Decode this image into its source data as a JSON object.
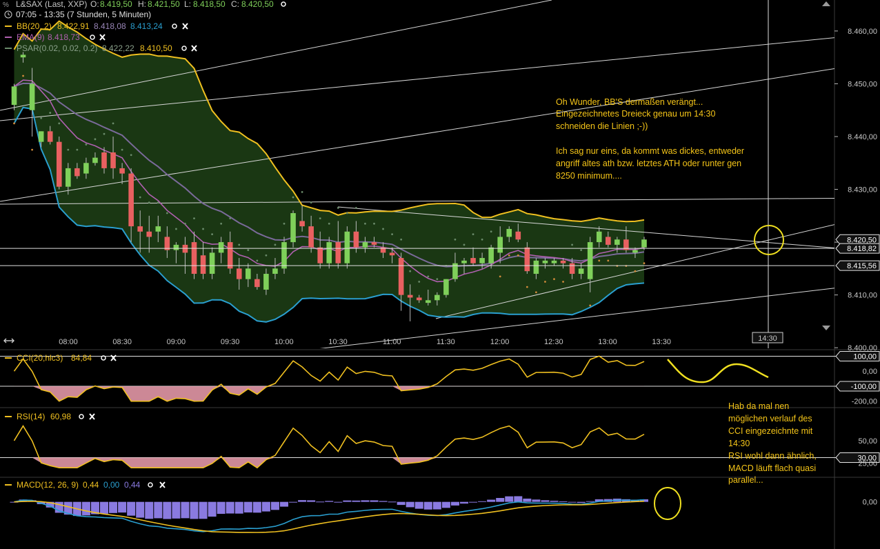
{
  "header": {
    "instrument": "L&SAX (Last, XXP)",
    "ohlc": {
      "o_label": "O:",
      "o": "8.419,50",
      "h_label": "H:",
      "h": "8.421,50",
      "l_label": "L:",
      "l": "8.418,50",
      "c_label": "C:",
      "c": "8.420,50"
    },
    "period": "07:05 - 13:35 (7 Stunden, 5 Minuten)"
  },
  "legend": {
    "bb": {
      "label": "BB(20, 2)",
      "v1": "8.422,91",
      "v2": "8.418,08",
      "v3": "8.413,24"
    },
    "ema": {
      "label": "EMA(9)",
      "v1": "8.418,73"
    },
    "psar": {
      "label": "PSAR(0.02, 0.02, 0.2)",
      "v1": "8.422,22",
      "v2": "8.410,50"
    },
    "cci": {
      "label": "CCI(20,hlc3)",
      "v1": "84,84"
    },
    "rsi": {
      "label": "RSI(14)",
      "v1": "60,98"
    },
    "macd": {
      "label": "MACD(12, 26, 9)",
      "v1": "0,44",
      "v2": "0,00",
      "v3": "0,44"
    }
  },
  "colors": {
    "bb": "#f0c020",
    "bb_fill": "#1b3a14",
    "ema": "#b060b0",
    "ema_slow": "#7a6a9a",
    "psar": "#6a8a6a",
    "lower_band": "#2a9fd0",
    "up": "#7fd05a",
    "down": "#e86060",
    "cci": "#f0c020",
    "cci_fill": "#f0a0b0",
    "hist": "#8a7ae0",
    "macd_signal": "#2a9fd0",
    "annotation": "#f5c518"
  },
  "chart_data": [
    {
      "type": "candlestick",
      "name": "price",
      "x": [
        "08:00",
        "08:30",
        "09:00",
        "09:30",
        "10:00",
        "10:30",
        "11:00",
        "11:30",
        "12:00",
        "12:30",
        "13:00",
        "13:30"
      ],
      "x_ticks": [
        "08:00",
        "08:30",
        "09:00",
        "09:30",
        "10:00",
        "10:30",
        "11:00",
        "11:30",
        "12:00",
        "12:30",
        "13:00",
        "13:30"
      ],
      "y_ticks": [
        "8.400,00",
        "8.410,00",
        "8.420,00",
        "8.430,00",
        "8.440,00",
        "8.450,00",
        "8.460,00"
      ],
      "y_tick_values": [
        8400,
        8410,
        8420,
        8430,
        8440,
        8450,
        8460
      ],
      "ylim": [
        8399.5,
        8466
      ],
      "price_tags": [
        {
          "label": "8.420,50",
          "value": 8420.5
        },
        {
          "label": "8.418,82",
          "value": 8418.82
        },
        {
          "label": "8.415,56",
          "value": 8415.56
        }
      ],
      "cursor": {
        "time_label": "14:30"
      },
      "candles": [
        {
          "o": 8446.0,
          "h": 8450.0,
          "l": 8445.0,
          "c": 8449.5
        },
        {
          "o": 8455.0,
          "h": 8456.0,
          "l": 8454.0,
          "c": 8455.5
        },
        {
          "o": 8445.0,
          "h": 8453.0,
          "l": 8440.0,
          "c": 8450.0
        },
        {
          "o": 8439.0,
          "h": 8441.0,
          "l": 8438.0,
          "c": 8441.0
        },
        {
          "o": 8441.0,
          "h": 8442.0,
          "l": 8438.5,
          "c": 8439.0
        },
        {
          "o": 8439.0,
          "h": 8440.0,
          "l": 8430.0,
          "c": 8430.5
        },
        {
          "o": 8430.5,
          "h": 8435.0,
          "l": 8429.0,
          "c": 8434.0
        },
        {
          "o": 8434.0,
          "h": 8435.0,
          "l": 8432.0,
          "c": 8432.5
        },
        {
          "o": 8433.0,
          "h": 8436.0,
          "l": 8432.0,
          "c": 8435.0
        },
        {
          "o": 8435.0,
          "h": 8437.0,
          "l": 8434.5,
          "c": 8436.0
        },
        {
          "o": 8437.0,
          "h": 8438.0,
          "l": 8433.0,
          "c": 8434.0
        },
        {
          "o": 8437.0,
          "h": 8440.0,
          "l": 8432.0,
          "c": 8434.0
        },
        {
          "o": 8434.0,
          "h": 8435.0,
          "l": 8431.0,
          "c": 8433.0
        },
        {
          "o": 8433.0,
          "h": 8434.0,
          "l": 8420.0,
          "c": 8423.0
        },
        {
          "o": 8423.0,
          "h": 8426.0,
          "l": 8418.0,
          "c": 8422.0
        },
        {
          "o": 8422.0,
          "h": 8425.0,
          "l": 8418.0,
          "c": 8421.0
        },
        {
          "o": 8422.0,
          "h": 8425.0,
          "l": 8420.0,
          "c": 8423.0
        },
        {
          "o": 8421.0,
          "h": 8423.0,
          "l": 8417.0,
          "c": 8418.5
        },
        {
          "o": 8418.5,
          "h": 8420.0,
          "l": 8416.0,
          "c": 8419.5
        },
        {
          "o": 8419.5,
          "h": 8421.0,
          "l": 8414.0,
          "c": 8418.0
        },
        {
          "o": 8420.0,
          "h": 8422.0,
          "l": 8413.0,
          "c": 8414.0
        },
        {
          "o": 8417.5,
          "h": 8420.0,
          "l": 8413.0,
          "c": 8414.0
        },
        {
          "o": 8414.0,
          "h": 8419.0,
          "l": 8413.0,
          "c": 8418.0
        },
        {
          "o": 8418.0,
          "h": 8421.0,
          "l": 8416.0,
          "c": 8420.0
        },
        {
          "o": 8420.0,
          "h": 8422.0,
          "l": 8414.0,
          "c": 8415.0
        },
        {
          "o": 8415.0,
          "h": 8417.0,
          "l": 8411.0,
          "c": 8413.0
        },
        {
          "o": 8413.0,
          "h": 8416.0,
          "l": 8411.5,
          "c": 8415.0
        },
        {
          "o": 8413.0,
          "h": 8414.0,
          "l": 8411.0,
          "c": 8411.5
        },
        {
          "o": 8411.0,
          "h": 8415.0,
          "l": 8410.0,
          "c": 8414.0
        },
        {
          "o": 8414.0,
          "h": 8417.0,
          "l": 8413.0,
          "c": 8415.0
        },
        {
          "o": 8415.0,
          "h": 8421.0,
          "l": 8414.0,
          "c": 8420.0
        },
        {
          "o": 8420.0,
          "h": 8426.0,
          "l": 8419.0,
          "c": 8425.5
        },
        {
          "o": 8424.0,
          "h": 8427.0,
          "l": 8422.0,
          "c": 8423.0
        },
        {
          "o": 8423.0,
          "h": 8425.0,
          "l": 8418.0,
          "c": 8419.0
        },
        {
          "o": 8419.0,
          "h": 8422.0,
          "l": 8415.0,
          "c": 8416.0
        },
        {
          "o": 8416.0,
          "h": 8421.0,
          "l": 8415.0,
          "c": 8420.0
        },
        {
          "o": 8420.0,
          "h": 8424.0,
          "l": 8415.0,
          "c": 8416.0
        },
        {
          "o": 8416.0,
          "h": 8423.0,
          "l": 8415.0,
          "c": 8422.0
        },
        {
          "o": 8422.0,
          "h": 8424.0,
          "l": 8418.0,
          "c": 8419.0
        },
        {
          "o": 8419.0,
          "h": 8421.0,
          "l": 8418.0,
          "c": 8420.0
        },
        {
          "o": 8420.0,
          "h": 8421.0,
          "l": 8419.0,
          "c": 8419.5
        },
        {
          "o": 8419.0,
          "h": 8420.0,
          "l": 8417.0,
          "c": 8418.0
        },
        {
          "o": 8418.0,
          "h": 8419.0,
          "l": 8416.0,
          "c": 8417.5
        },
        {
          "o": 8417.0,
          "h": 8418.0,
          "l": 8407.0,
          "c": 8410.0
        },
        {
          "o": 8410.0,
          "h": 8412.0,
          "l": 8405.0,
          "c": 8409.5
        },
        {
          "o": 8409.5,
          "h": 8410.0,
          "l": 8408.5,
          "c": 8409.0
        },
        {
          "o": 8408.5,
          "h": 8411.0,
          "l": 8408.0,
          "c": 8409.0
        },
        {
          "o": 8409.0,
          "h": 8410.5,
          "l": 8408.0,
          "c": 8410.0
        },
        {
          "o": 8410.0,
          "h": 8413.0,
          "l": 8409.5,
          "c": 8413.0
        },
        {
          "o": 8413.0,
          "h": 8418.0,
          "l": 8412.5,
          "c": 8416.0
        },
        {
          "o": 8416.0,
          "h": 8417.0,
          "l": 8414.0,
          "c": 8416.5
        },
        {
          "o": 8417.0,
          "h": 8419.0,
          "l": 8415.5,
          "c": 8416.0
        },
        {
          "o": 8416.0,
          "h": 8418.0,
          "l": 8415.0,
          "c": 8417.0
        },
        {
          "o": 8416.0,
          "h": 8419.5,
          "l": 8415.0,
          "c": 8419.0
        },
        {
          "o": 8418.0,
          "h": 8423.0,
          "l": 8416.0,
          "c": 8421.0
        },
        {
          "o": 8421.0,
          "h": 8423.0,
          "l": 8420.0,
          "c": 8422.5
        },
        {
          "o": 8422.0,
          "h": 8423.5,
          "l": 8420.0,
          "c": 8420.5
        },
        {
          "o": 8419.0,
          "h": 8420.0,
          "l": 8414.0,
          "c": 8414.5
        },
        {
          "o": 8414.0,
          "h": 8417.0,
          "l": 8413.0,
          "c": 8416.5
        },
        {
          "o": 8416.0,
          "h": 8417.0,
          "l": 8415.0,
          "c": 8416.5
        },
        {
          "o": 8416.0,
          "h": 8417.0,
          "l": 8415.5,
          "c": 8416.5
        },
        {
          "o": 8416.5,
          "h": 8417.0,
          "l": 8415.0,
          "c": 8416.0
        },
        {
          "o": 8416.0,
          "h": 8417.0,
          "l": 8413.0,
          "c": 8414.0
        },
        {
          "o": 8414.0,
          "h": 8416.0,
          "l": 8413.0,
          "c": 8415.0
        },
        {
          "o": 8413.0,
          "h": 8421.0,
          "l": 8410.5,
          "c": 8420.0
        },
        {
          "o": 8420.0,
          "h": 8423.0,
          "l": 8419.0,
          "c": 8422.0
        },
        {
          "o": 8421.0,
          "h": 8422.0,
          "l": 8419.0,
          "c": 8419.5
        },
        {
          "o": 8419.5,
          "h": 8421.0,
          "l": 8418.0,
          "c": 8420.5
        },
        {
          "o": 8420.5,
          "h": 8423.0,
          "l": 8418.0,
          "c": 8418.5
        },
        {
          "o": 8418.0,
          "h": 8419.0,
          "l": 8417.0,
          "c": 8418.5
        },
        {
          "o": 8419.0,
          "h": 8421.0,
          "l": 8418.5,
          "c": 8420.5
        }
      ]
    },
    {
      "type": "line",
      "name": "CCI(20,hlc3)",
      "y_ticks": [
        "100,00",
        "0,00",
        "-100,00",
        "-200,00"
      ],
      "y_tick_values": [
        100,
        0,
        -100,
        -200
      ],
      "ylim": [
        -220,
        130
      ],
      "levels": [
        {
          "label": "100,00",
          "value": 100
        },
        {
          "label": "-100,00",
          "value": -100
        }
      ]
    },
    {
      "type": "line",
      "name": "RSI(14)",
      "y_ticks": [
        "50,00",
        "30,00",
        "25,00"
      ],
      "y_tick_values": [
        50,
        30,
        25
      ],
      "ylim": [
        10,
        85
      ],
      "levels": [
        {
          "label": "30,00",
          "value": 30
        }
      ]
    },
    {
      "type": "bar",
      "name": "MACD(12, 26, 9)",
      "y_ticks": [
        "0,00"
      ],
      "y_tick_values": [
        0
      ],
      "ylim": [
        -12,
        6
      ]
    }
  ],
  "annotations": {
    "note1": [
      "Oh Wunder, BB'S dermaßen verängt...",
      "Eingezeichnetes Dreieck genau um 14:30",
      "schneiden die Linien ;-))",
      "",
      "Ich sag nur eins, da kommt was dickes, entweder",
      "angriff altes ath bzw. letztes ATH oder runter gen",
      "8250 minimum...."
    ],
    "note2": [
      "Hab da mal nen",
      "möglichen verlauf des",
      "CCI eingezeichnte mit",
      "14:30",
      "RSI wohl dann ähnlich,",
      "MACD läuft flach quasi",
      "parallel..."
    ]
  }
}
